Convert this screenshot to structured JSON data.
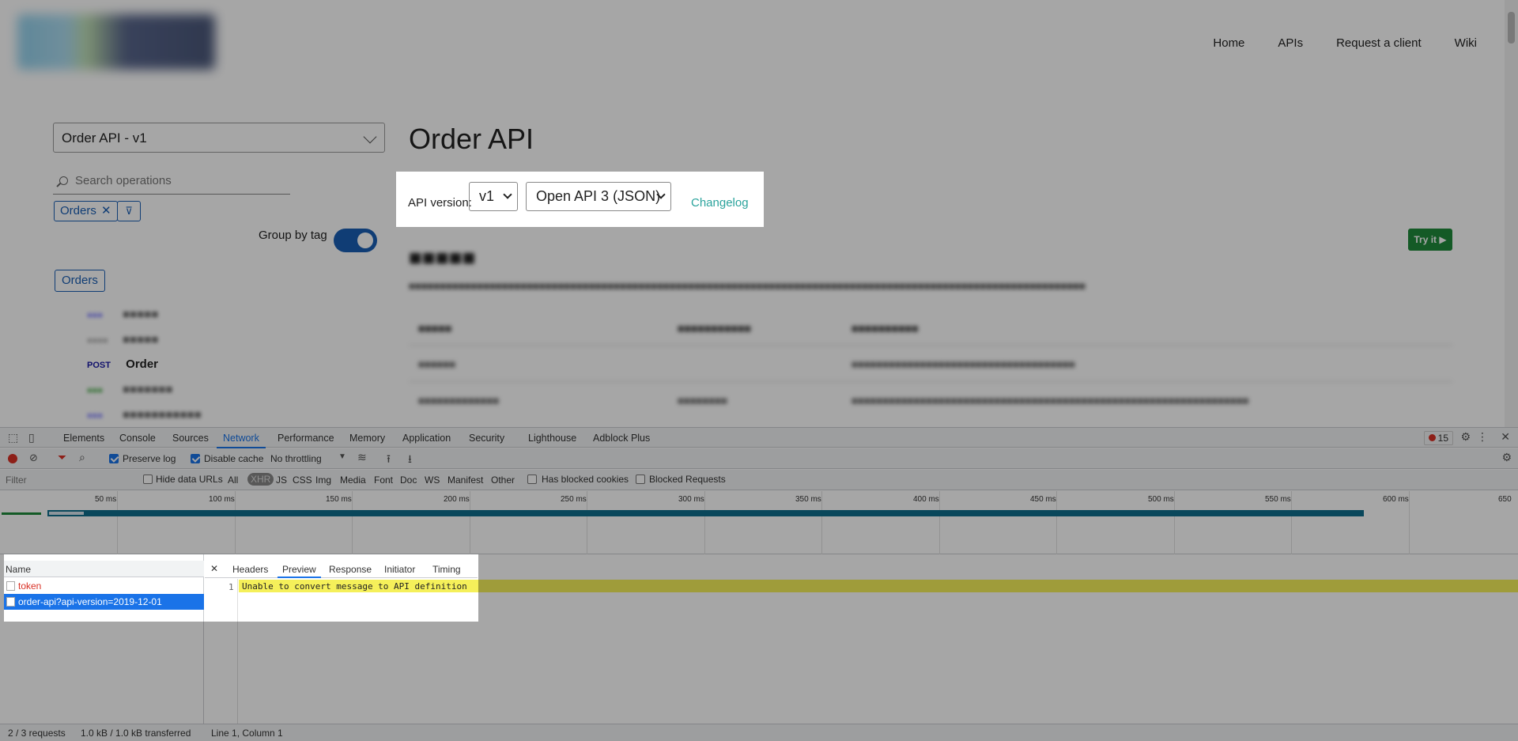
{
  "site": {
    "nav": [
      "Home",
      "APIs",
      "Request a client",
      "Wiki"
    ],
    "api_select": "Order API - v1",
    "search_placeholder": "Search operations",
    "tag_chip": "Orders",
    "group_by_tag": "Group by tag",
    "ops_tag": "Orders",
    "operations": [
      {
        "method": "POST",
        "name": "Order",
        "method_color": "#1a1aa6"
      }
    ],
    "title": "Order API",
    "try_it": "Try it",
    "version_label": "API version:",
    "version_value": "v1",
    "format_value": "Open API 3 (JSON)",
    "changelog": "Changelog"
  },
  "devtools": {
    "tabs": [
      "Elements",
      "Console",
      "Sources",
      "Network",
      "Performance",
      "Memory",
      "Application",
      "Security",
      "Lighthouse",
      "Adblock Plus"
    ],
    "active_tab": "Network",
    "error_count": "15",
    "toolbar": {
      "preserve_log": "Preserve log",
      "disable_cache": "Disable cache",
      "throttling": "No throttling"
    },
    "filter": {
      "placeholder": "Filter",
      "hide_data_urls": "Hide data URLs",
      "types": [
        "All",
        "XHR",
        "JS",
        "CSS",
        "Img",
        "Media",
        "Font",
        "Doc",
        "WS",
        "Manifest",
        "Other"
      ],
      "active_type": "XHR",
      "has_blocked_cookies": "Has blocked cookies",
      "blocked_requests": "Blocked Requests"
    },
    "timeline_ticks": [
      "50 ms",
      "100 ms",
      "150 ms",
      "200 ms",
      "250 ms",
      "300 ms",
      "350 ms",
      "400 ms",
      "450 ms",
      "500 ms",
      "550 ms",
      "600 ms",
      "650"
    ],
    "name_header": "Name",
    "requests": [
      {
        "name": "token",
        "error": true
      },
      {
        "name": "order-api?api-version=2019-12-01",
        "selected": true
      }
    ],
    "detail_tabs": [
      "Headers",
      "Preview",
      "Response",
      "Initiator",
      "Timing"
    ],
    "active_detail_tab": "Preview",
    "preview_line_no": "1",
    "preview_text": "Unable to convert message to API definition",
    "status_requests": "2 / 3 requests",
    "status_transferred": "1.0 kB / 1.0 kB transferred",
    "status_cursor": "Line 1, Column 1"
  }
}
